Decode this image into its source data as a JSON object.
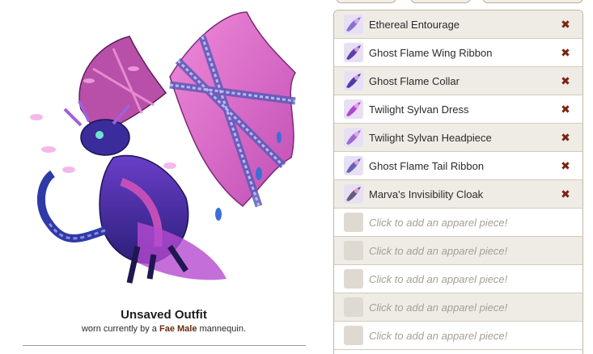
{
  "outfit": {
    "title": "Unsaved Outfit",
    "worn_prefix": "worn currently by a",
    "mannequin": "Fae Male",
    "worn_suffix": "mannequin."
  },
  "apparel": {
    "items": [
      {
        "label": "Ethereal Entourage",
        "icon": "ethereal-entourage-icon",
        "color": "#8a6fd6",
        "remove_glyph": "✖"
      },
      {
        "label": "Ghost Flame Wing Ribbon",
        "icon": "ghost-flame-wing-ribbon-icon",
        "color": "#5b3fb0",
        "remove_glyph": "✖"
      },
      {
        "label": "Ghost Flame Collar",
        "icon": "ghost-flame-collar-icon",
        "color": "#4a3da8",
        "remove_glyph": "✖"
      },
      {
        "label": "Twilight Sylvan Dress",
        "icon": "twilight-sylvan-dress-icon",
        "color": "#b145d6",
        "remove_glyph": "✖"
      },
      {
        "label": "Twilight Sylvan Headpiece",
        "icon": "twilight-sylvan-headpiece-icon",
        "color": "#9a6bd0",
        "remove_glyph": "✖"
      },
      {
        "label": "Ghost Flame Tail Ribbon",
        "icon": "ghost-flame-tail-ribbon-icon",
        "color": "#6a5fb8",
        "remove_glyph": "✖"
      },
      {
        "label": "Marva's Invisibility Cloak",
        "icon": "marvas-invisibility-cloak-icon",
        "color": "#6b5a7a",
        "remove_glyph": "✖"
      }
    ],
    "empty_slots": [
      {
        "label": "Click to add an apparel piece!"
      },
      {
        "label": "Click to add an apparel piece!"
      },
      {
        "label": "Click to add an apparel piece!"
      },
      {
        "label": "Click to add an apparel piece!"
      },
      {
        "label": "Click to add an apparel piece!"
      }
    ]
  },
  "colors": {
    "accent_remove": "#7b2410",
    "row_alt": "#efece5",
    "border": "#c3b7a4"
  }
}
